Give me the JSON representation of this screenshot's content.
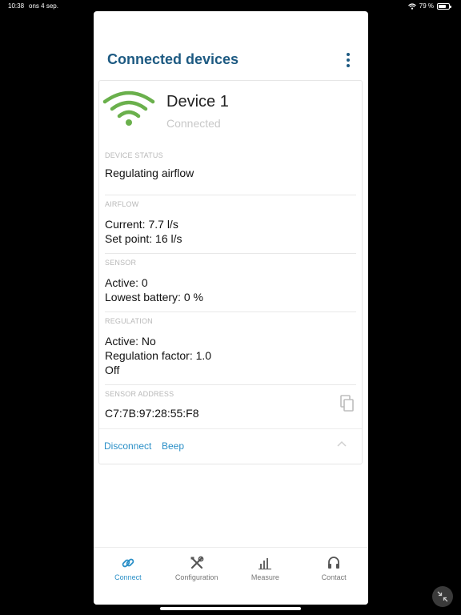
{
  "status_bar": {
    "time": "10:38",
    "date": "ons 4 sep.",
    "battery": "79 %",
    "battery_level": 0.79
  },
  "header": {
    "title": "Connected devices"
  },
  "device": {
    "name": "Device 1",
    "state": "Connected",
    "icon": "wifi-icon",
    "icon_color": "#6ab04c"
  },
  "sections": {
    "device_status": {
      "label": "DEVICE STATUS",
      "lines": [
        "Regulating airflow"
      ]
    },
    "airflow": {
      "label": "AIRFLOW",
      "lines": [
        "Current: 7.7 l/s",
        "Set point: 16 l/s"
      ]
    },
    "sensor": {
      "label": "SENSOR",
      "lines": [
        "Active: 0",
        "Lowest battery: 0 %"
      ]
    },
    "regulation": {
      "label": "REGULATION",
      "lines": [
        "Active: No",
        "Regulation factor: 1.0",
        "Off"
      ]
    },
    "sensor_address": {
      "label": "SENSOR ADDRESS",
      "lines": [
        "C7:7B:97:28:55:F8"
      ]
    }
  },
  "actions": {
    "disconnect": "Disconnect",
    "beep": "Beep"
  },
  "tabs": [
    {
      "label": "Connect",
      "icon": "link-icon",
      "active": true
    },
    {
      "label": "Configuration",
      "icon": "tools-icon",
      "active": false
    },
    {
      "label": "Measure",
      "icon": "bar-chart-icon",
      "active": false
    },
    {
      "label": "Contact",
      "icon": "headset-icon",
      "active": false
    }
  ],
  "colors": {
    "title": "#1d5a82",
    "accent": "#2a8fc7",
    "wifi": "#6ab04c"
  }
}
